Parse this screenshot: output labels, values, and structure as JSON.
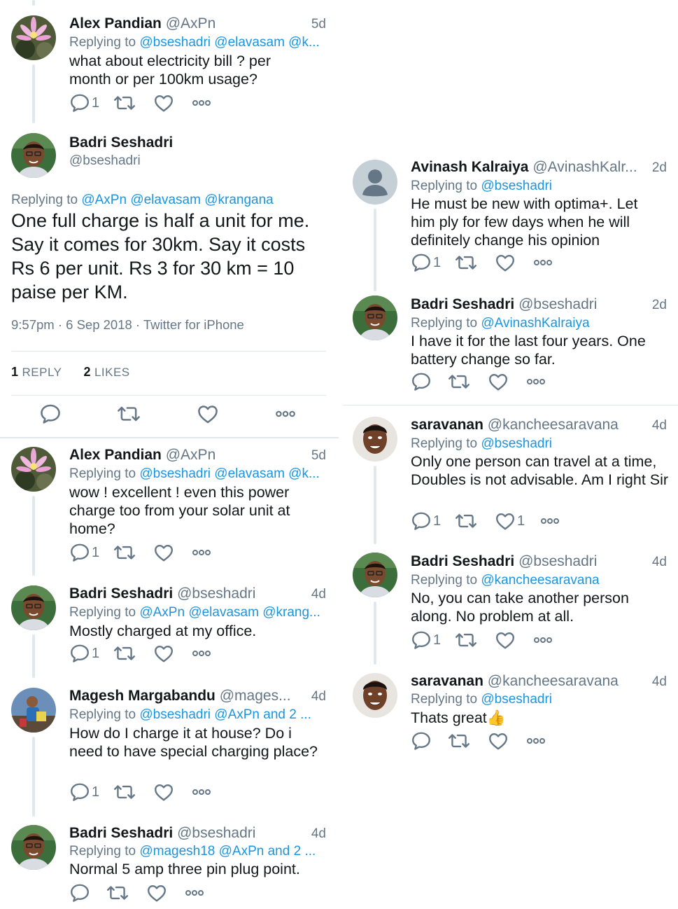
{
  "left": {
    "t1": {
      "name": "Alex Pandian",
      "handle": "@AxPn",
      "time": "5d",
      "replying": "Replying to",
      "mentions": "@bseshadri @elavasam @k...",
      "text": "what about electricity bill ? per month or per 100km usage?",
      "reply_count": "1"
    },
    "main": {
      "name": "Badri Seshadri",
      "handle": "@bseshadri",
      "replying": "Replying to",
      "mentions": "@AxPn @elavasam @krangana",
      "text": "One full charge is half a unit for me. Say it comes for 30km. Say it costs Rs 6 per unit. Rs 3 for 30 km = 10 paise per KM.",
      "meta": "9:57pm · 6 Sep 2018 · Twitter for iPhone",
      "replies_num": "1",
      "replies_label": "REPLY",
      "likes_num": "2",
      "likes_label": "LIKES"
    },
    "t3": {
      "name": "Alex Pandian",
      "handle": "@AxPn",
      "time": "5d",
      "replying": "Replying to",
      "mentions": "@bseshadri @elavasam @k...",
      "text": "wow ! excellent ! even this power charge too from your solar unit at home?",
      "reply_count": "1"
    },
    "t4": {
      "name": "Badri Seshadri",
      "handle": "@bseshadri",
      "time": "4d",
      "replying": "Replying to",
      "mentions": "@AxPn @elavasam @krang...",
      "text": "Mostly charged at my office.",
      "reply_count": "1"
    },
    "t5": {
      "name": "Magesh Margabandu",
      "handle": "@mages...",
      "time": "4d",
      "replying": "Replying to",
      "mentions": "@bseshadri @AxPn and 2 ...",
      "text": "How do I charge it at house? Do i need to have special charging place?",
      "reply_count": "1"
    },
    "t6": {
      "name": "Badri Seshadri",
      "handle": "@bseshadri",
      "time": "4d",
      "replying": "Replying to",
      "mentions": "@magesh18 @AxPn and 2 ...",
      "text": "Normal 5 amp three pin plug point."
    }
  },
  "right": {
    "r1": {
      "name": "Avinash Kalraiya",
      "handle": "@AvinashKalr...",
      "time": "2d",
      "replying": "Replying to",
      "mentions": "@bseshadri",
      "text": "He must be new with optima+. Let him ply for few days when he will definitely change his opinion",
      "reply_count": "1"
    },
    "r2": {
      "name": "Badri Seshadri",
      "handle": "@bseshadri",
      "time": "2d",
      "replying": "Replying to",
      "mentions": "@AvinashKalraiya",
      "text": "I have it for the last four years. One battery change so far."
    },
    "r3": {
      "name": "saravanan",
      "handle": "@kancheesaravana",
      "time": "4d",
      "replying": "Replying to",
      "mentions": "@bseshadri",
      "text": "Only one person can travel at a time,  Doubles is not advisable. Am I right Sir",
      "reply_count": "1",
      "like_count": "1"
    },
    "r4": {
      "name": "Badri Seshadri",
      "handle": "@bseshadri",
      "time": "4d",
      "replying": "Replying to",
      "mentions": "@kancheesaravana",
      "text": "No, you can take another person along. No problem at all.",
      "reply_count": "1"
    },
    "r5": {
      "name": "saravanan",
      "handle": "@kancheesaravana",
      "time": "4d",
      "replying": "Replying to",
      "mentions": "@bseshadri",
      "text": "Thats great",
      "emoji": "👍"
    }
  },
  "icons": {
    "reply": "reply-icon",
    "retweet": "retweet-icon",
    "like": "like-icon",
    "more": "more-icon"
  },
  "colors": {
    "link": "#1b95e0",
    "muted": "#657786",
    "text": "#14171a",
    "divider": "#e1e8ed"
  }
}
